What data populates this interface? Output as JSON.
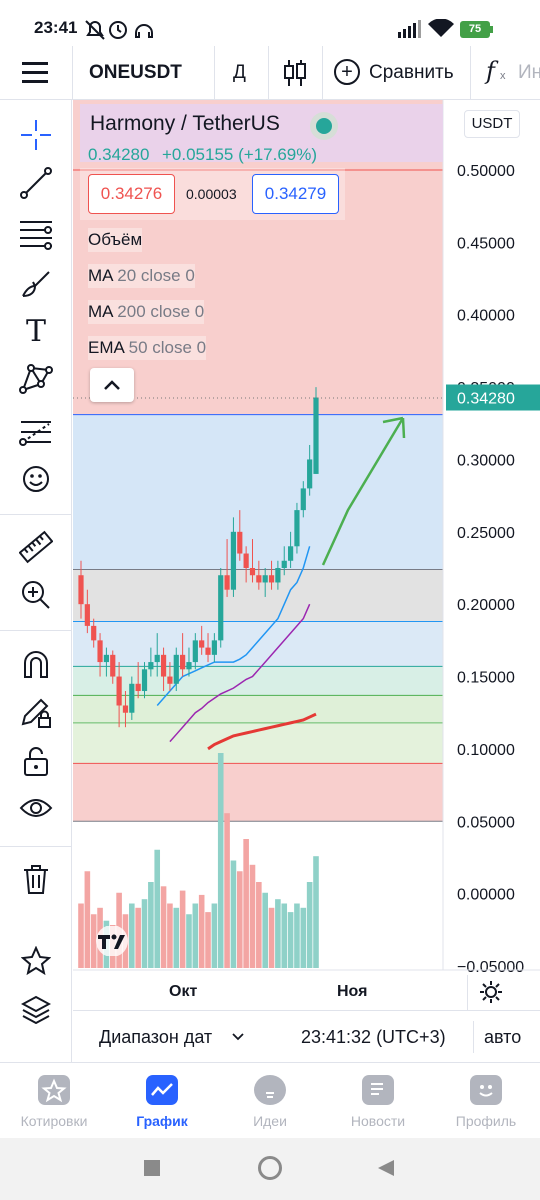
{
  "status_bar": {
    "time": "23:41",
    "battery": "75"
  },
  "toolbar": {
    "symbol": "ONEUSDT",
    "interval": "Д",
    "compare_label": "Сравнить",
    "indicators_label": "Ин"
  },
  "legend": {
    "title": "Harmony / TetherUS",
    "last_price": "0.34280",
    "change": "+0.05155 (+17.69%)",
    "bid": "0.34276",
    "spread": "0.00003",
    "ask": "0.34279",
    "volume_label": "Объём",
    "indicators": [
      {
        "name": "MA",
        "params": "20 close 0"
      },
      {
        "name": "MA",
        "params": "200 close 0"
      },
      {
        "name": "EMA",
        "params": "50 close 0"
      }
    ]
  },
  "price_axis": {
    "currency": "USDT",
    "ticks": [
      "0.50000",
      "0.45000",
      "0.40000",
      "0.35000",
      "0.30000",
      "0.25000",
      "0.20000",
      "0.15000",
      "0.10000",
      "0.05000",
      "0.00000",
      "−0.05000"
    ],
    "last_price_label": "0.34280"
  },
  "time_axis": {
    "labels": [
      "Окт",
      "Ноя"
    ]
  },
  "bottom_bar": {
    "date_range": "Диапазон дат",
    "clock": "23:41:32 (UTC+3)",
    "auto": "авто"
  },
  "nav": [
    {
      "label": "Котировки",
      "icon": "star-icon",
      "active": false
    },
    {
      "label": "График",
      "icon": "chart-icon",
      "active": true
    },
    {
      "label": "Идеи",
      "icon": "bulb-icon",
      "active": false
    },
    {
      "label": "Новости",
      "icon": "news-icon",
      "active": false
    },
    {
      "label": "Профиль",
      "icon": "smile-icon",
      "active": false
    }
  ],
  "colors": {
    "up": "#26a69a",
    "down": "#ef5350",
    "accent": "#2962ff",
    "ma20": "#2196f3",
    "ma200": "#9c27b0",
    "ema50": "#e53935",
    "arrow": "#4caf50"
  },
  "chart_data": {
    "type": "candlestick",
    "symbol": "ONEUSDT",
    "interval": "1D",
    "ylim": [
      -0.05,
      0.5
    ],
    "last_price": 0.3428,
    "fib_levels": [
      0.5,
      0.331,
      0.224,
      0.188,
      0.157,
      0.137,
      0.118,
      0.09,
      0.05
    ],
    "candles": [
      {
        "o": 0.22,
        "h": 0.23,
        "l": 0.19,
        "c": 0.2
      },
      {
        "o": 0.2,
        "h": 0.21,
        "l": 0.18,
        "c": 0.185
      },
      {
        "o": 0.185,
        "h": 0.19,
        "l": 0.17,
        "c": 0.175
      },
      {
        "o": 0.175,
        "h": 0.18,
        "l": 0.15,
        "c": 0.16
      },
      {
        "o": 0.16,
        "h": 0.17,
        "l": 0.15,
        "c": 0.165
      },
      {
        "o": 0.165,
        "h": 0.168,
        "l": 0.145,
        "c": 0.15
      },
      {
        "o": 0.15,
        "h": 0.16,
        "l": 0.115,
        "c": 0.13
      },
      {
        "o": 0.13,
        "h": 0.14,
        "l": 0.115,
        "c": 0.125
      },
      {
        "o": 0.125,
        "h": 0.15,
        "l": 0.12,
        "c": 0.145
      },
      {
        "o": 0.145,
        "h": 0.16,
        "l": 0.135,
        "c": 0.14
      },
      {
        "o": 0.14,
        "h": 0.16,
        "l": 0.135,
        "c": 0.155
      },
      {
        "o": 0.155,
        "h": 0.17,
        "l": 0.15,
        "c": 0.16
      },
      {
        "o": 0.16,
        "h": 0.18,
        "l": 0.15,
        "c": 0.165
      },
      {
        "o": 0.165,
        "h": 0.17,
        "l": 0.14,
        "c": 0.15
      },
      {
        "o": 0.15,
        "h": 0.16,
        "l": 0.14,
        "c": 0.145
      },
      {
        "o": 0.145,
        "h": 0.17,
        "l": 0.14,
        "c": 0.165
      },
      {
        "o": 0.165,
        "h": 0.18,
        "l": 0.15,
        "c": 0.155
      },
      {
        "o": 0.155,
        "h": 0.17,
        "l": 0.15,
        "c": 0.16
      },
      {
        "o": 0.16,
        "h": 0.18,
        "l": 0.155,
        "c": 0.175
      },
      {
        "o": 0.175,
        "h": 0.185,
        "l": 0.165,
        "c": 0.17
      },
      {
        "o": 0.17,
        "h": 0.18,
        "l": 0.16,
        "c": 0.165
      },
      {
        "o": 0.165,
        "h": 0.18,
        "l": 0.16,
        "c": 0.175
      },
      {
        "o": 0.175,
        "h": 0.225,
        "l": 0.17,
        "c": 0.22
      },
      {
        "o": 0.22,
        "h": 0.245,
        "l": 0.205,
        "c": 0.21
      },
      {
        "o": 0.21,
        "h": 0.26,
        "l": 0.205,
        "c": 0.25
      },
      {
        "o": 0.25,
        "h": 0.265,
        "l": 0.23,
        "c": 0.235
      },
      {
        "o": 0.235,
        "h": 0.24,
        "l": 0.215,
        "c": 0.225
      },
      {
        "o": 0.225,
        "h": 0.245,
        "l": 0.215,
        "c": 0.22
      },
      {
        "o": 0.22,
        "h": 0.23,
        "l": 0.21,
        "c": 0.215
      },
      {
        "o": 0.215,
        "h": 0.225,
        "l": 0.205,
        "c": 0.22
      },
      {
        "o": 0.22,
        "h": 0.23,
        "l": 0.21,
        "c": 0.215
      },
      {
        "o": 0.215,
        "h": 0.23,
        "l": 0.21,
        "c": 0.225
      },
      {
        "o": 0.225,
        "h": 0.24,
        "l": 0.22,
        "c": 0.23
      },
      {
        "o": 0.23,
        "h": 0.25,
        "l": 0.225,
        "c": 0.24
      },
      {
        "o": 0.24,
        "h": 0.27,
        "l": 0.235,
        "c": 0.265
      },
      {
        "o": 0.265,
        "h": 0.285,
        "l": 0.26,
        "c": 0.28
      },
      {
        "o": 0.28,
        "h": 0.31,
        "l": 0.275,
        "c": 0.3
      },
      {
        "o": 0.29,
        "h": 0.35,
        "l": 0.29,
        "c": 0.3428
      }
    ],
    "ma20": [
      0.13,
      0.135,
      0.14,
      0.145,
      0.15,
      0.152,
      0.154,
      0.156,
      0.158,
      0.16,
      0.16,
      0.16,
      0.16,
      0.162,
      0.165,
      0.17,
      0.175,
      0.18,
      0.185,
      0.19,
      0.2,
      0.21,
      0.215,
      0.225,
      0.24
    ],
    "ma200": [
      0.105,
      0.11,
      0.115,
      0.12,
      0.125,
      0.128,
      0.132,
      0.135,
      0.138,
      0.14,
      0.142,
      0.145,
      0.148,
      0.15,
      0.155,
      0.16,
      0.165,
      0.17,
      0.175,
      0.18,
      0.185,
      0.19,
      0.2
    ],
    "ema50": [
      0.1,
      0.103,
      0.105,
      0.107,
      0.109,
      0.11,
      0.111,
      0.112,
      0.113,
      0.114,
      0.115,
      0.116,
      0.117,
      0.118,
      0.119,
      0.12,
      0.122,
      0.124
    ],
    "volume": [
      30,
      45,
      25,
      28,
      22,
      20,
      35,
      25,
      30,
      28,
      32,
      40,
      55,
      38,
      30,
      28,
      36,
      25,
      30,
      34,
      26,
      30,
      100,
      72,
      50,
      45,
      60,
      48,
      40,
      35,
      28,
      32,
      30,
      26,
      30,
      28,
      40,
      52
    ]
  }
}
